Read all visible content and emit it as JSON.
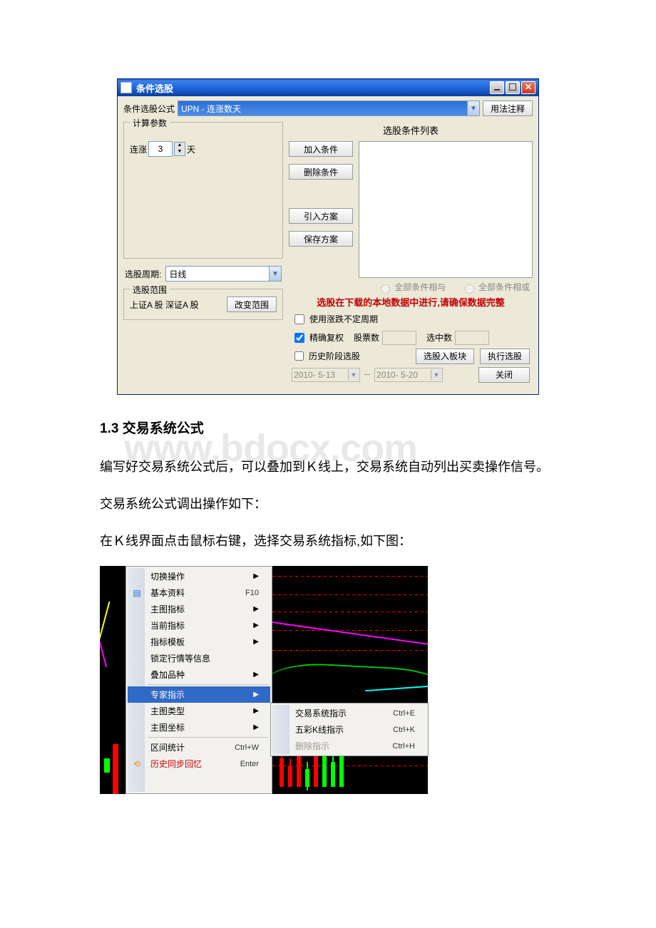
{
  "dialog": {
    "title": "条件选股",
    "formula_label": "条件选股公式",
    "formula_combo": "UPN            - 连涨数天",
    "usage_btn": "用法注释",
    "params_legend": "计算参数",
    "param_label_pre": "连涨",
    "param_value": "3",
    "param_label_post": "天",
    "period_label": "选股周期:",
    "period_value": "日线",
    "range_legend": "选股范围",
    "range_text": "上证A 股  深证A 股",
    "change_range_btn": "改变范围",
    "cond_list_header": "选股条件列表",
    "add_cond_btn": "加入条件",
    "del_cond_btn": "删除条件",
    "import_plan_btn": "引入方案",
    "save_plan_btn": "保存方案",
    "radio_and": "全部条件相与",
    "radio_or": "全部条件相或",
    "notice": "选股在下载的本地数据中进行,请确保数据完整",
    "chk_varperiod": "使用涨跌不定周期",
    "chk_fuquan": "精确复权",
    "stock_count_label": "股票数",
    "selected_count_label": "选中数",
    "chk_history": "历史阶段选股",
    "date_from": "2010- 5-13",
    "date_to": "2010- 5-20",
    "btn_to_board": "选股入板块",
    "btn_execute": "执行选股",
    "btn_close": "关闭"
  },
  "doc": {
    "heading": "1.3 交易系统公式",
    "watermark": "www.bdocx.com",
    "p1": "编写好交易系统公式后，可以叠加到Ｋ线上，交易系统自动列出买卖操作信号。",
    "p2": "交易系统公式调出操作如下：",
    "p3": "在Ｋ线界面点击鼠标右键，选择交易系统指标,如下图："
  },
  "menu": {
    "items": [
      {
        "label": "切换操作",
        "arrow": true
      },
      {
        "label": "基本资料",
        "shortcut": "F10",
        "icon": "📄"
      },
      {
        "label": "主图指标",
        "arrow": true
      },
      {
        "label": "当前指标",
        "arrow": true
      },
      {
        "label": "指标模板",
        "arrow": true
      },
      {
        "label": "锁定行情等信息"
      },
      {
        "label": "叠加品种",
        "arrow": true
      },
      {
        "sep": true
      },
      {
        "label": "专家指示",
        "arrow": true,
        "hover": true
      },
      {
        "label": "主图类型",
        "arrow": true
      },
      {
        "label": "主图坐标",
        "arrow": true
      },
      {
        "sep": true
      },
      {
        "label": "区间统计",
        "shortcut": "Ctrl+W"
      },
      {
        "label": "历史同步回忆",
        "shortcut": "Enter",
        "red": true,
        "icon": "↩️"
      }
    ],
    "submenu": [
      {
        "label": "交易系统指示",
        "shortcut": "Ctrl+E"
      },
      {
        "label": "五彩K线指示",
        "shortcut": "Ctrl+K"
      },
      {
        "label": "删除指示",
        "shortcut": "Ctrl+H",
        "disabled": true
      }
    ]
  }
}
